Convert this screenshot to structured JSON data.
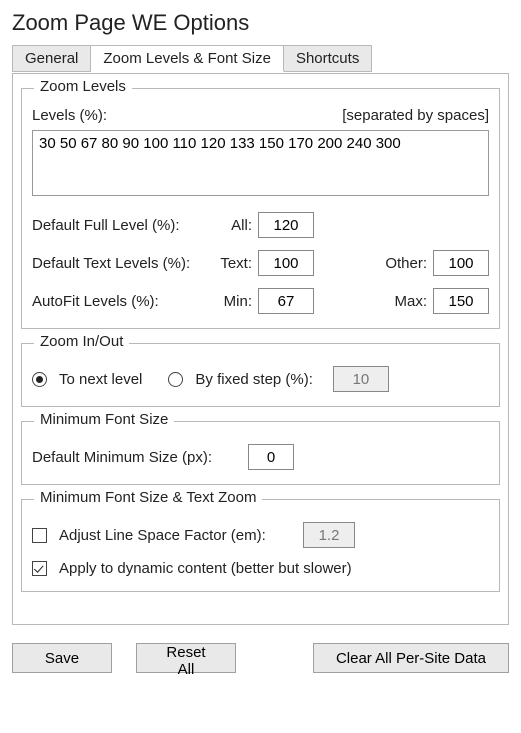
{
  "title": "Zoom Page WE Options",
  "tabs": {
    "general": "General",
    "levels": "Zoom Levels & Font Size",
    "shortcuts": "Shortcuts"
  },
  "zoomLevels": {
    "legend": "Zoom Levels",
    "levels_label": "Levels (%):",
    "levels_hint": "[separated by spaces]",
    "levels_value": "30 50 67 80 90 100 110 120 133 150 170 200 240 300",
    "default_full_label": "Default Full Level (%):",
    "all_label": "All:",
    "all_value": "120",
    "default_text_label": "Default Text Levels (%):",
    "text_label": "Text:",
    "text_value": "100",
    "other_label": "Other:",
    "other_value": "100",
    "autofit_label": "AutoFit Levels (%):",
    "min_label": "Min:",
    "min_value": "67",
    "max_label": "Max:",
    "max_value": "150"
  },
  "zoomInOut": {
    "legend": "Zoom In/Out",
    "to_next": "To next level",
    "by_fixed": "By fixed step (%):",
    "step_value": "10"
  },
  "minFont": {
    "legend": "Minimum Font Size",
    "default_label": "Default Minimum Size (px):",
    "default_value": "0"
  },
  "minFontTextZoom": {
    "legend": "Minimum Font Size & Text Zoom",
    "adjust_label": "Adjust Line Space Factor (em):",
    "adjust_value": "1.2",
    "apply_label": "Apply to dynamic content (better but slower)"
  },
  "buttons": {
    "save": "Save",
    "reset": "Reset All",
    "clear": "Clear All Per-Site Data"
  }
}
